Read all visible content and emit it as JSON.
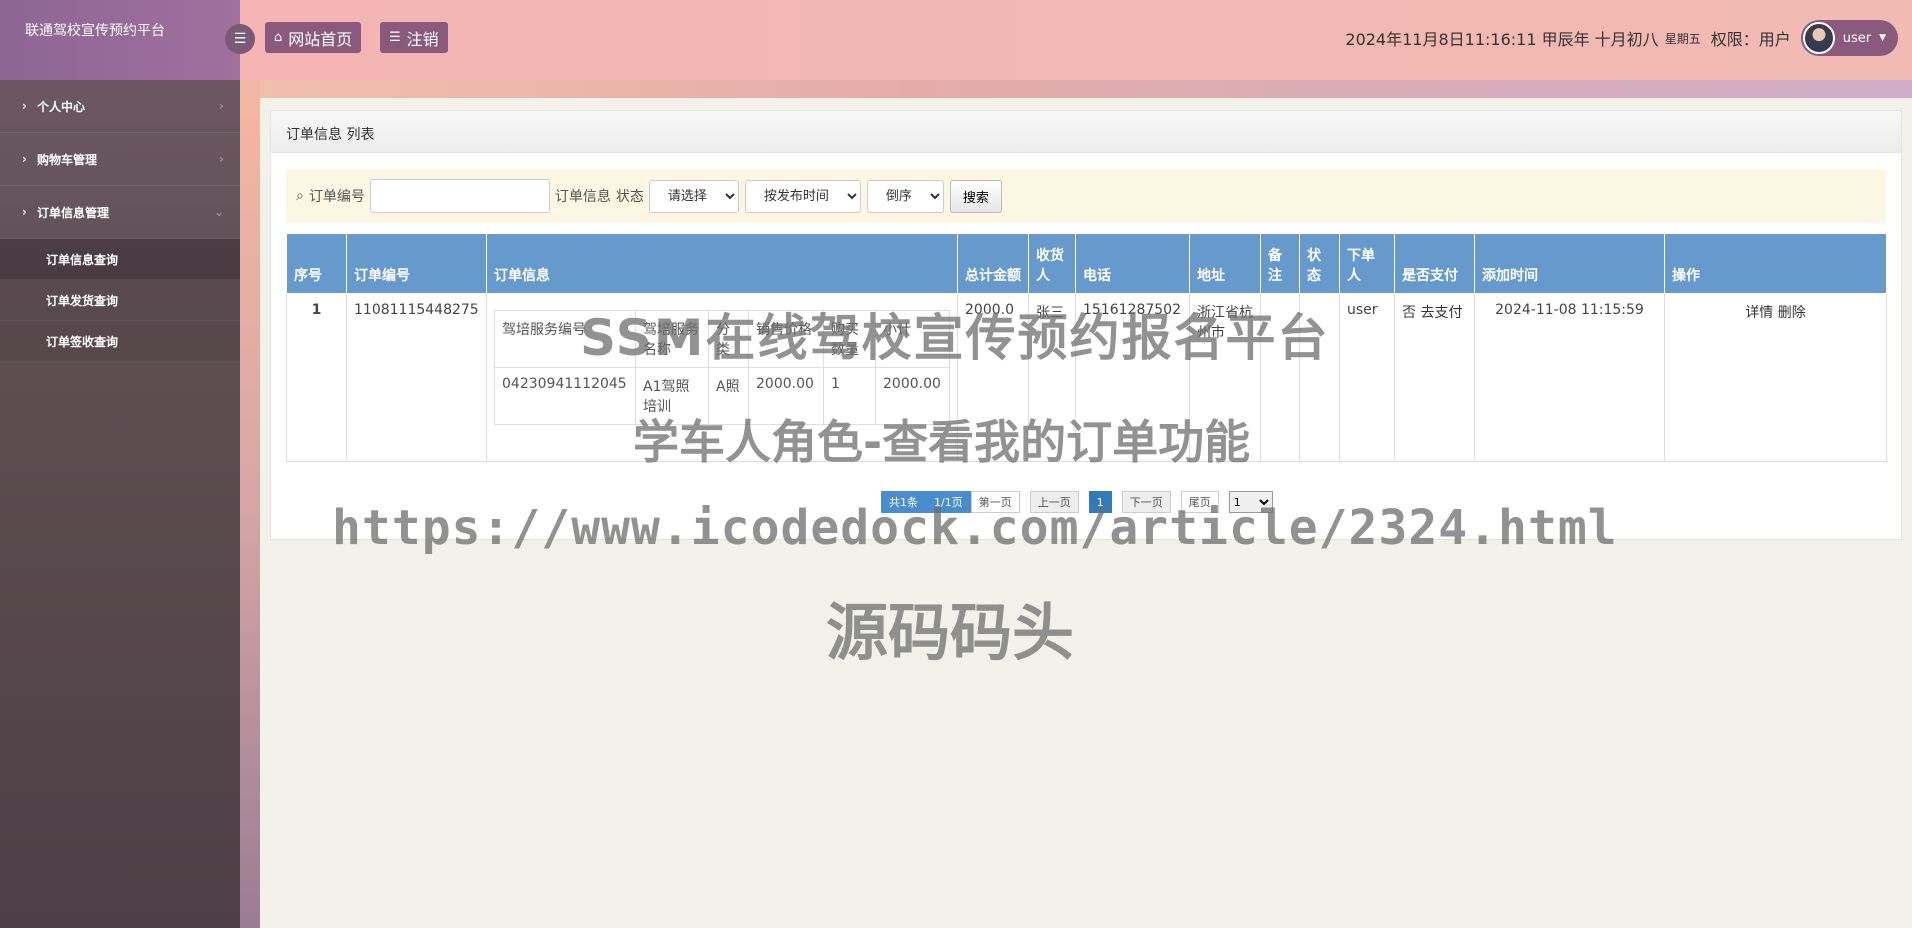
{
  "sidebar": {
    "brand": "联通驾校宣传预约平台",
    "menus": [
      {
        "label": "个人中心"
      },
      {
        "label": "购物车管理"
      },
      {
        "label": "订单信息管理"
      }
    ],
    "submenu": [
      {
        "label": "订单信息查询"
      },
      {
        "label": "订单发货查询"
      },
      {
        "label": "订单签收查询"
      }
    ]
  },
  "topbar": {
    "home_label": "网站首页",
    "logout_label": "注销",
    "datetime": "2024年11月8日11:16:11 甲辰年 十月初八",
    "weekday": "星期五",
    "permission": "权限：用户",
    "username": "user"
  },
  "panel": {
    "title": "订单信息 列表"
  },
  "search": {
    "order_no_label": "订单编号",
    "order_info_label": "订单信息",
    "status_label": "状态",
    "status_value": "请选择",
    "sort_field": "按发布时间",
    "sort_order": "倒序",
    "search_button": "搜索"
  },
  "table": {
    "headers": [
      "序号",
      "订单编号",
      "订单信息",
      "总计金额",
      "收货人",
      "电话",
      "地址",
      "备注",
      "状态",
      "下单人",
      "是否支付",
      "添加时间",
      "操作"
    ],
    "rows": [
      {
        "index": "1",
        "order_no": "11081115448275",
        "total": "2000.0",
        "receiver": "张三",
        "phone": "15161287502",
        "address": "浙江省杭州市",
        "remark": "",
        "status": "",
        "orderer": "user",
        "paid": "否",
        "pay_link": "去支付",
        "created": "2024-11-08 11:15:59",
        "detail_label": "详情",
        "delete_label": "删除",
        "items_headers": [
          "驾培服务编号",
          "驾培服务名称",
          "分类",
          "销售价格",
          "购买数量",
          "小计"
        ],
        "items": [
          {
            "code": "04230941112045",
            "name": "A1驾照培训",
            "category": "A照",
            "price": "2000.00",
            "qty": "1",
            "subtotal": "2000.00"
          }
        ]
      }
    ]
  },
  "pagination": {
    "summary": "共1条",
    "pages": "1/1页",
    "first": "第一页",
    "prev": "上一页",
    "current": "1",
    "next": "下一页",
    "last": "尾页",
    "select_value": "1"
  },
  "watermarks": {
    "line1": "SSM在线驾校宣传预约报名平台",
    "line2": "学车人角色-查看我的订单功能",
    "line3": "https://www.icodedock.com/article/2324.html",
    "line4": "源码码头"
  }
}
